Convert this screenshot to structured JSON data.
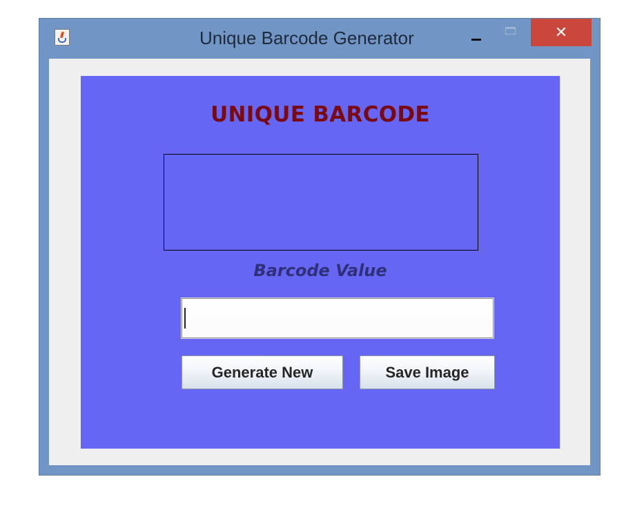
{
  "window": {
    "title": "Unique Barcode Generator",
    "icon": "java-coffee-cup-icon",
    "controls": {
      "minimize_icon": "minimize-icon",
      "maximize_icon": "maximize-icon",
      "close_label": "✕"
    }
  },
  "panel": {
    "heading": "UNIQUE BARCODE",
    "value_label": "Barcode Value",
    "value_input": {
      "value": "",
      "placeholder": ""
    },
    "buttons": {
      "generate": "Generate New",
      "save": "Save Image"
    }
  },
  "colors": {
    "panel_background": "#6666f4",
    "heading": "#7a0a12",
    "value_label": "#303078",
    "title_bar": "#7195c4",
    "close_button": "#c9473b"
  }
}
